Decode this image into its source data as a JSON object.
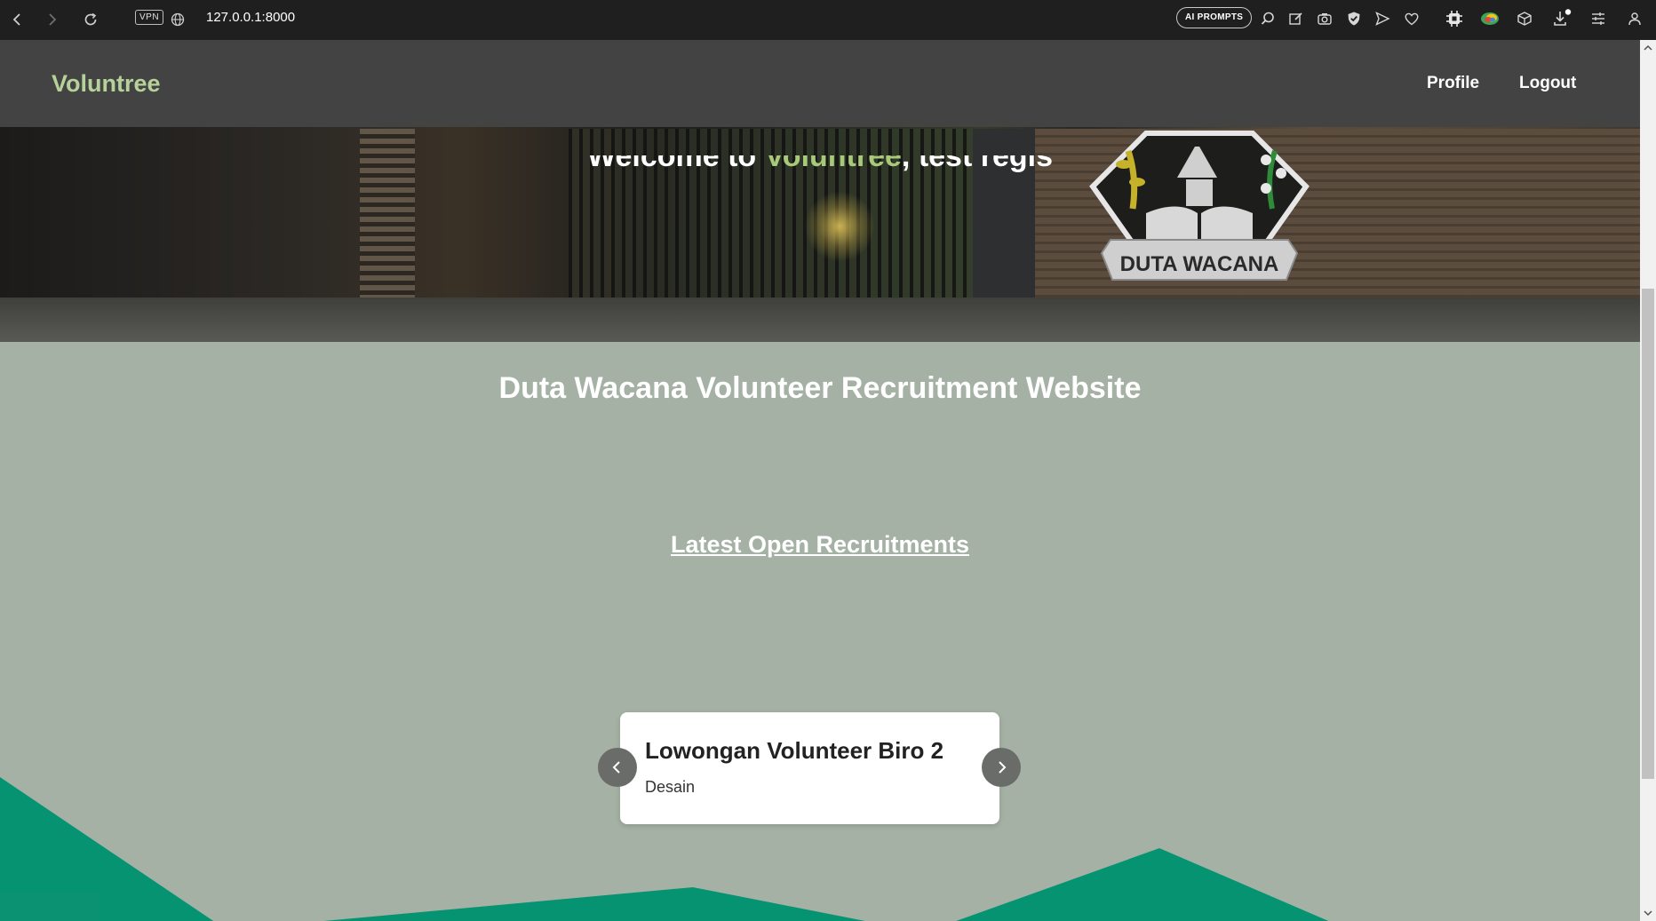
{
  "browser": {
    "vpn_label": "VPN",
    "url": "127.0.0.1:8000",
    "ai_prompts_label": "AI PROMPTS"
  },
  "navbar": {
    "brand": "Voluntree",
    "links": [
      "Profile",
      "Logout"
    ]
  },
  "hero": {
    "welcome_prefix": "Welcome to ",
    "welcome_brand": "Voluntree",
    "welcome_suffix": ", test regis",
    "logo_text": "DUTA WACANA"
  },
  "main": {
    "title": "Duta Wacana Volunteer Recruitment Website",
    "section_title": "Latest Open Recruitments"
  },
  "carousel": {
    "card_title": "Lowongan Volunteer Biro 2",
    "card_category": "Desain"
  },
  "colors": {
    "brand_green": "#b6d29a",
    "page_bg": "#a4b1a4",
    "wave_green": "#059372",
    "navbar_bg": "#434343"
  }
}
